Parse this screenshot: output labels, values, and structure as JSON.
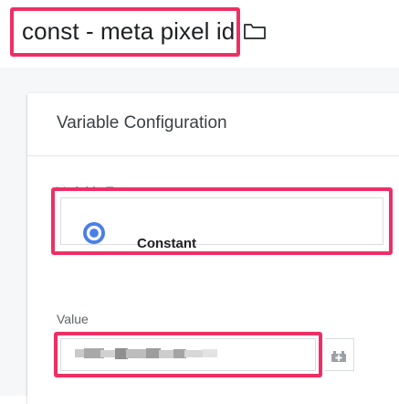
{
  "variable": {
    "name": "const - meta pixel id"
  },
  "icons": {
    "folder": "folder-icon",
    "constant_type": "constant-type-icon",
    "variable_picker": "add-variable-icon"
  },
  "config": {
    "heading": "Variable Configuration",
    "type_label": "Variable Type",
    "type_value": "Constant",
    "value_label": "Value"
  },
  "colors": {
    "highlight": "#ee2f65",
    "type_icon": "#4a7fe8"
  }
}
